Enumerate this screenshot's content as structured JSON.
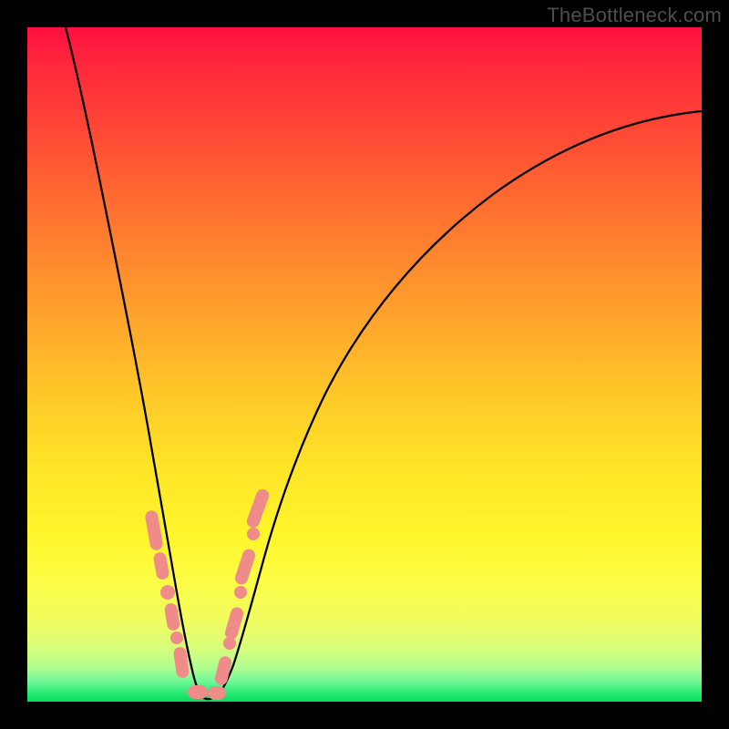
{
  "watermark": "TheBottleneck.com",
  "chart_data": {
    "type": "line",
    "title": "",
    "xlabel": "",
    "ylabel": "",
    "xlim": [
      0,
      100
    ],
    "ylim": [
      0,
      100
    ],
    "grid": false,
    "legend": null,
    "annotations": [
      "TheBottleneck.com"
    ],
    "background": "vertical-gradient red-to-green",
    "series": [
      {
        "name": "left-branch",
        "x": [
          5,
          7,
          9,
          11,
          13,
          15,
          16.5,
          18,
          19,
          20,
          21,
          22,
          22.8,
          23.5,
          24.2,
          25
        ],
        "y": [
          100,
          88,
          76,
          64,
          52,
          40,
          32,
          24,
          18,
          13,
          9,
          6,
          4,
          2.5,
          1.5,
          1
        ]
      },
      {
        "name": "right-branch",
        "x": [
          25,
          26,
          27,
          28,
          29.5,
          31,
          33,
          36,
          40,
          46,
          54,
          64,
          76,
          88,
          100
        ],
        "y": [
          1,
          2,
          4,
          7,
          12,
          19,
          28,
          40,
          52,
          62,
          70,
          76,
          80.5,
          83.5,
          85.5
        ]
      }
    ],
    "vertex_x": 25,
    "vertex_y": 1,
    "highlight_regions": [
      {
        "branch": "left",
        "x_range": [
          17.5,
          20.5
        ],
        "style": "pill"
      },
      {
        "branch": "left",
        "x_range": [
          21,
          22
        ],
        "style": "dot"
      },
      {
        "branch": "left",
        "x_range": [
          22.5,
          24
        ],
        "style": "pill"
      },
      {
        "branch": "bottom",
        "x_range": [
          24.3,
          27.5
        ],
        "style": "pill"
      },
      {
        "branch": "right",
        "x_range": [
          27.8,
          28.5
        ],
        "style": "dot"
      },
      {
        "branch": "right",
        "x_range": [
          28.8,
          30.2
        ],
        "style": "pill"
      },
      {
        "branch": "right",
        "x_range": [
          30.5,
          31
        ],
        "style": "dot"
      },
      {
        "branch": "right",
        "x_range": [
          31.3,
          33.5
        ],
        "style": "pill"
      }
    ]
  }
}
